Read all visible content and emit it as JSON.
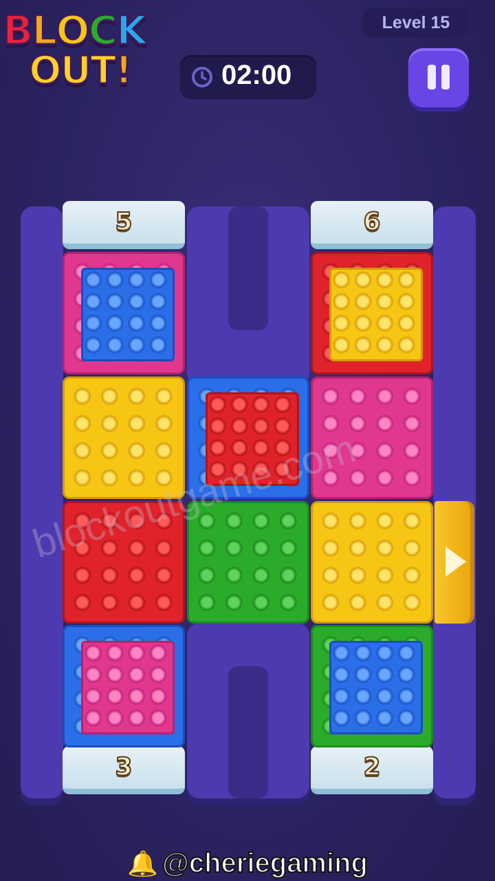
{
  "header": {
    "logo_line1": "BLOCK",
    "logo_line2": "OUT!",
    "level_label": "Level 15",
    "timer": "02:00"
  },
  "board": {
    "gates": [
      {
        "position": "top-left",
        "count": "5",
        "color": "#c9e1ec"
      },
      {
        "position": "top-right",
        "count": "6",
        "color": "#c9e1ec"
      },
      {
        "position": "bottom-left",
        "count": "3",
        "color": "#c9e1ec"
      },
      {
        "position": "bottom-right",
        "count": "2",
        "color": "#c9e1ec"
      }
    ],
    "side_exit": {
      "side": "right",
      "color": "#f7c514",
      "icon": "play-arrow-icon"
    },
    "rows": [
      [
        {
          "outer": "pink",
          "inner": "blue"
        },
        null,
        {
          "outer": "red",
          "inner": "yellow"
        }
      ],
      [
        {
          "outer": "yellow",
          "inner": null
        },
        {
          "outer": "blue",
          "inner": "red"
        },
        {
          "outer": "pink",
          "inner": null
        }
      ],
      [
        {
          "outer": "red",
          "inner": null
        },
        {
          "outer": "green",
          "inner": null
        },
        {
          "outer": "yellow",
          "inner": null
        }
      ],
      [
        {
          "outer": "blue",
          "inner": "pink"
        },
        null,
        {
          "outer": "green",
          "inner": "blue"
        }
      ]
    ]
  },
  "watermark": "blockoutgame.com",
  "footer": {
    "handle": "@cheriegaming",
    "icon": "bell-icon"
  }
}
